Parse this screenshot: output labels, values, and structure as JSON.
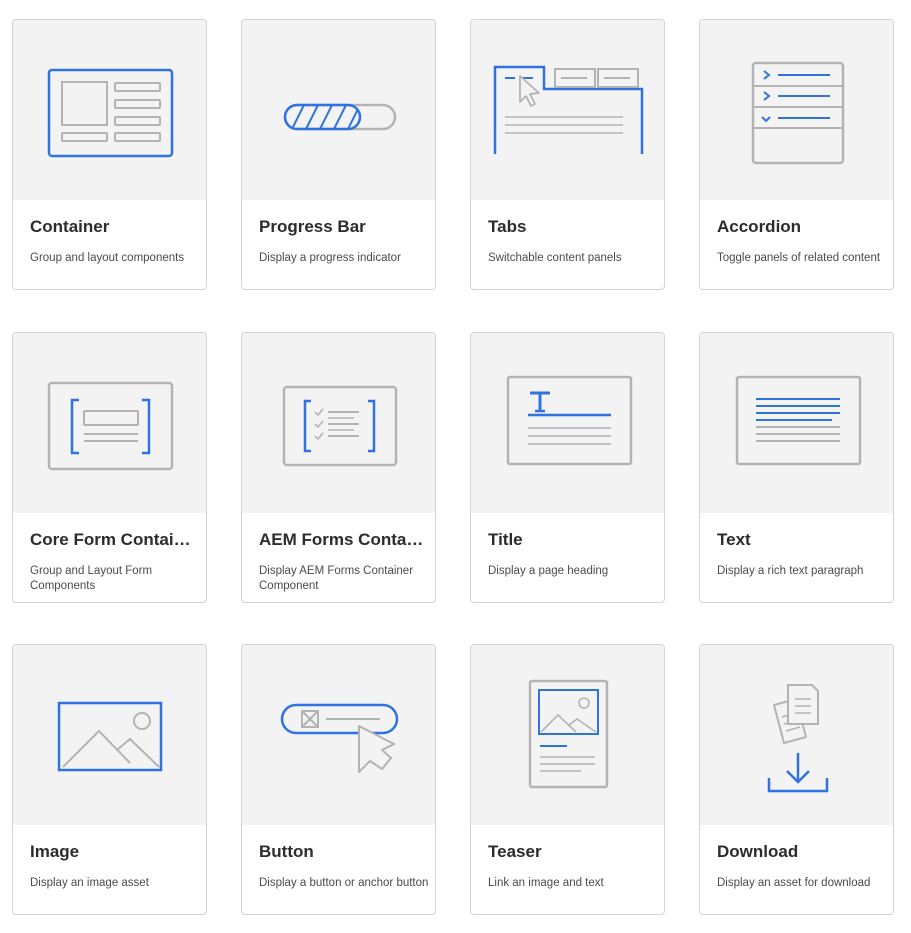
{
  "components": [
    {
      "title": "Container",
      "description": "Group and layout components",
      "icon": "container-icon"
    },
    {
      "title": "Progress Bar",
      "description": "Display a progress indicator",
      "icon": "progress-bar-icon"
    },
    {
      "title": "Tabs",
      "description": "Switchable content panels",
      "icon": "tabs-icon"
    },
    {
      "title": "Accordion",
      "description": "Toggle panels of related content",
      "icon": "accordion-icon"
    },
    {
      "title": "Core Form Container",
      "description": "Group and Layout Form Components",
      "icon": "core-form-container-icon"
    },
    {
      "title": "AEM Forms Container",
      "description": "Display AEM Forms Container Component",
      "icon": "aem-forms-container-icon"
    },
    {
      "title": "Title",
      "description": "Display a page heading",
      "icon": "title-icon"
    },
    {
      "title": "Text",
      "description": "Display a rich text paragraph",
      "icon": "text-icon"
    },
    {
      "title": "Image",
      "description": "Display an image asset",
      "icon": "image-icon"
    },
    {
      "title": "Button",
      "description": "Display a button or anchor button",
      "icon": "button-icon"
    },
    {
      "title": "Teaser",
      "description": "Link an image and text",
      "icon": "teaser-icon"
    },
    {
      "title": "Download",
      "description": "Display an asset for download",
      "icon": "download-icon"
    }
  ],
  "colors": {
    "accent": "#2f73e0",
    "line_gray": "#b3b3b3",
    "thumb_bg": "#f3f3f3"
  }
}
